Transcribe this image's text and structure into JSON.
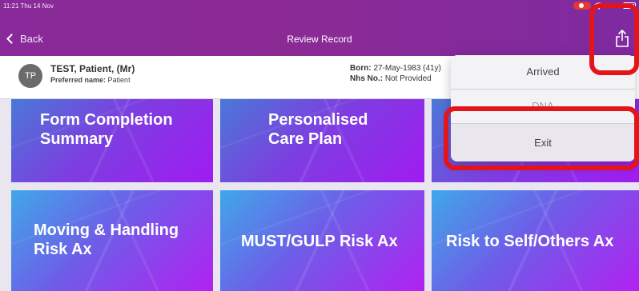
{
  "status": {
    "time_date": "11:21  Thu 14 Nov",
    "battery": "97%"
  },
  "nav": {
    "back_label": "Back",
    "title": "Review Record"
  },
  "patient": {
    "initials": "TP",
    "name": "TEST, Patient, (Mr)",
    "preferred_label": "Preferred name:",
    "preferred_value": "Patient",
    "born_label": "Born:",
    "born_value": "27-May-1983 (41y)",
    "nhs_label": "Nhs No.:",
    "nhs_value": "Not Provided"
  },
  "tiles": [
    {
      "label_line1": "Form Completion",
      "label_line2": "Summary"
    },
    {
      "label_line1": "Personalised",
      "label_line2": "Care Plan"
    },
    {
      "label_line1": "Moving & Handling",
      "label_line2": "Risk Ax"
    },
    {
      "label": "MUST/GULP Risk Ax"
    },
    {
      "label": "Risk to Self/Others Ax"
    }
  ],
  "menu": {
    "items": [
      "Arrived",
      "DNA",
      "Exit"
    ]
  },
  "colors": {
    "highlight": "#e4141b",
    "header": "#8a2a9a"
  }
}
